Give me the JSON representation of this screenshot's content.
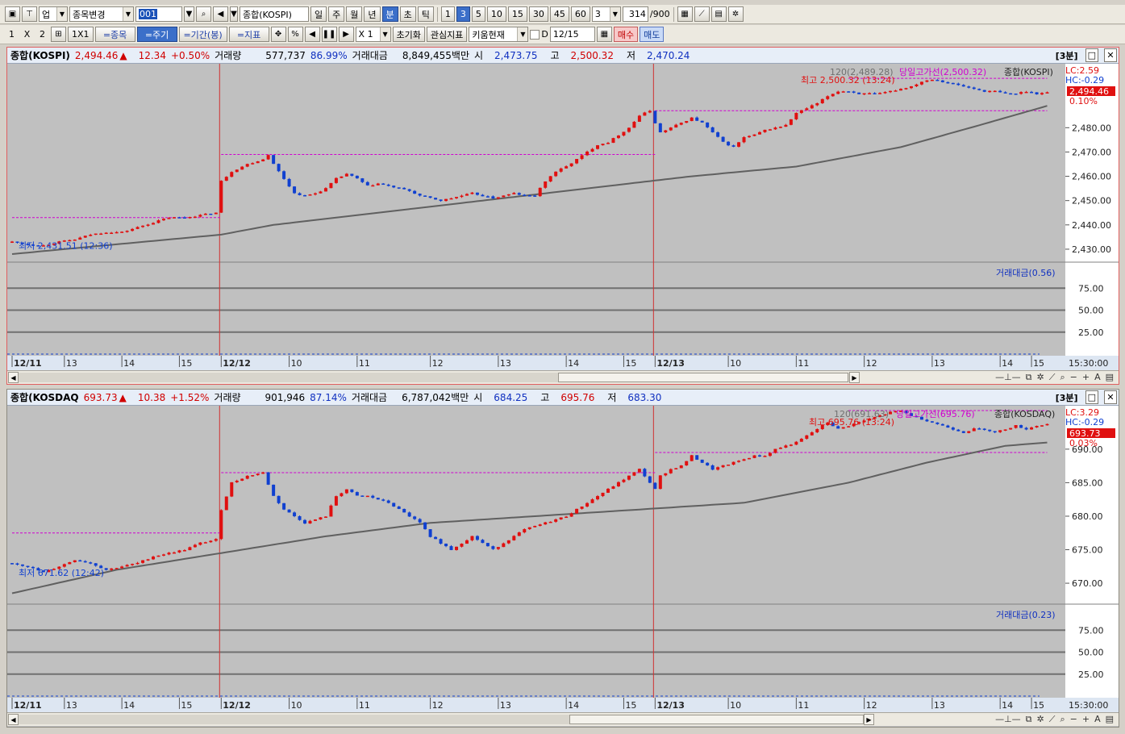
{
  "toolbar1": {
    "type_select": "업",
    "change_select": "종목변경",
    "code": "001",
    "name_field": "종합(KOSPI)",
    "periods": [
      "일",
      "주",
      "월",
      "년",
      "분",
      "초",
      "틱"
    ],
    "active_period": "분",
    "minute_options": [
      "1",
      "3",
      "5",
      "10",
      "15",
      "30",
      "45",
      "60"
    ],
    "active_minute": "3",
    "interval_value": "3",
    "count_value": "314",
    "count_max": "/900"
  },
  "toolbar2": {
    "layout_labels": [
      "1",
      "X",
      "2"
    ],
    "grid_label": "1X1",
    "tabs": [
      "=종목",
      "=주기",
      "=기간(봉)",
      "=지표"
    ],
    "active_tab": "=주기",
    "zoom_value": "X 1",
    "reset_label": "초기화",
    "watch_label": "관심지표",
    "kiwoom_label": "키움현재",
    "date_prefix": "D",
    "date_value": "12/15",
    "buy_label": "매수",
    "sell_label": "매도"
  },
  "panels": [
    {
      "name": "종합(KOSPI)",
      "price": "2,494.46",
      "arrow": "▲",
      "change": "12.34",
      "change_pct": "+0.50%",
      "volume_label": "거래량",
      "volume": "577,737",
      "volume_pct": "86.99%",
      "amount_label": "거래대금",
      "amount": "8,849,455백만",
      "open_label": "시",
      "open": "2,473.75",
      "high_label": "고",
      "high": "2,500.32",
      "low_label": "저",
      "low": "2,470.24",
      "period_badge": "[3분]",
      "y_labels": [
        "2,480.00",
        "2,470.00",
        "2,460.00",
        "2,450.00",
        "2,440.00",
        "2,430.00"
      ],
      "lc": "LC:2.59",
      "hc": "HC:-0.29",
      "last_price_tag": "2,494.46",
      "last_pct_tag": "0.10%",
      "ma_label": "120(2,489.28)",
      "high_line_label": "당일고가선(2,500.32)",
      "legend_name": "종합(KOSPI)",
      "max_label": "최고 2,500.32 (13:24)",
      "min_label": "최저 2,431.51 (12:36)",
      "sub_label": "거래대금(0.56)",
      "sub_y_labels": [
        "75.00",
        "50.00",
        "25.00"
      ],
      "x_labels": [
        "12/11",
        "13",
        "14",
        "15",
        "12/12",
        "10",
        "11",
        "12",
        "13",
        "14",
        "15",
        "12/13",
        "10",
        "11",
        "12",
        "13",
        "14",
        "15"
      ],
      "time_label": "15:30:00",
      "chart_data": {
        "type": "candlestick",
        "ylim": [
          2425,
          2505
        ],
        "sub_ylim": [
          0,
          100
        ],
        "close_points": [
          [
            0,
            2433
          ],
          [
            3,
            2432
          ],
          [
            6,
            2431.5
          ],
          [
            9,
            2433
          ],
          [
            12,
            2434
          ],
          [
            15,
            2436
          ],
          [
            18,
            2437
          ],
          [
            21,
            2437
          ],
          [
            24,
            2439
          ],
          [
            27,
            2441
          ],
          [
            30,
            2443
          ],
          [
            33,
            2443
          ],
          [
            36,
            2444
          ],
          [
            39,
            2445
          ],
          [
            40,
            2458
          ],
          [
            42,
            2462
          ],
          [
            45,
            2465
          ],
          [
            48,
            2467
          ],
          [
            49,
            2469
          ],
          [
            50,
            2465
          ],
          [
            52,
            2459
          ],
          [
            54,
            2453
          ],
          [
            56,
            2452
          ],
          [
            58,
            2453
          ],
          [
            60,
            2455
          ],
          [
            62,
            2459
          ],
          [
            64,
            2461
          ],
          [
            66,
            2459
          ],
          [
            68,
            2456
          ],
          [
            70,
            2457
          ],
          [
            72,
            2456
          ],
          [
            74,
            2455
          ],
          [
            76,
            2454
          ],
          [
            78,
            2452
          ],
          [
            80,
            2451
          ],
          [
            82,
            2450
          ],
          [
            84,
            2451
          ],
          [
            86,
            2452
          ],
          [
            88,
            2453
          ],
          [
            90,
            2452
          ],
          [
            92,
            2451
          ],
          [
            94,
            2452
          ],
          [
            96,
            2453
          ],
          [
            98,
            2452
          ],
          [
            100,
            2452
          ],
          [
            102,
            2458
          ],
          [
            104,
            2462
          ],
          [
            106,
            2464
          ],
          [
            108,
            2467
          ],
          [
            110,
            2470
          ],
          [
            112,
            2473
          ],
          [
            114,
            2474
          ],
          [
            116,
            2477
          ],
          [
            118,
            2480
          ],
          [
            120,
            2485
          ],
          [
            122,
            2487
          ],
          [
            123,
            2482
          ],
          [
            124,
            2478
          ],
          [
            126,
            2480
          ],
          [
            128,
            2482
          ],
          [
            130,
            2484
          ],
          [
            132,
            2482
          ],
          [
            134,
            2478
          ],
          [
            136,
            2474
          ],
          [
            138,
            2472
          ],
          [
            140,
            2476
          ],
          [
            142,
            2477
          ],
          [
            144,
            2479
          ],
          [
            146,
            2480
          ],
          [
            148,
            2481
          ],
          [
            150,
            2486
          ],
          [
            152,
            2488
          ],
          [
            154,
            2490
          ],
          [
            156,
            2493
          ],
          [
            158,
            2495
          ],
          [
            160,
            2495
          ],
          [
            162,
            2494
          ],
          [
            164,
            2494
          ],
          [
            166,
            2494
          ],
          [
            168,
            2495
          ],
          [
            170,
            2496
          ],
          [
            172,
            2497
          ],
          [
            174,
            2499
          ],
          [
            176,
            2500
          ],
          [
            178,
            2499
          ],
          [
            180,
            2498
          ],
          [
            182,
            2497
          ],
          [
            184,
            2496
          ],
          [
            186,
            2495
          ],
          [
            188,
            2495
          ],
          [
            190,
            2494
          ],
          [
            192,
            2494
          ],
          [
            194,
            2495
          ],
          [
            196,
            2494
          ],
          [
            198,
            2494.5
          ]
        ],
        "ma_points": [
          [
            0,
            2428
          ],
          [
            20,
            2432
          ],
          [
            40,
            2436
          ],
          [
            50,
            2440
          ],
          [
            70,
            2445
          ],
          [
            90,
            2450
          ],
          [
            110,
            2455
          ],
          [
            130,
            2460
          ],
          [
            150,
            2464
          ],
          [
            170,
            2472
          ],
          [
            185,
            2481
          ],
          [
            198,
            2489
          ]
        ],
        "high_line": 2500.32,
        "prev_high_steps": [
          [
            0,
            40,
            2443
          ],
          [
            40,
            123,
            2469
          ],
          [
            123,
            198,
            2487
          ]
        ]
      }
    },
    {
      "name": "종합(KOSDAQ",
      "price": "693.73",
      "arrow": "▲",
      "change": "10.38",
      "change_pct": "+1.52%",
      "volume_label": "거래량",
      "volume": "901,946",
      "volume_pct": "87.14%",
      "amount_label": "거래대금",
      "amount": "6,787,042백만",
      "open_label": "시",
      "open": "684.25",
      "high_label": "고",
      "high": "695.76",
      "low_label": "저",
      "low": "683.30",
      "period_badge": "[3분]",
      "y_labels": [
        "690.00",
        "685.00",
        "680.00",
        "675.00",
        "670.00"
      ],
      "lc": "LC:3.29",
      "hc": "HC:-0.29",
      "last_price_tag": "693.73",
      "last_pct_tag": "0.03%",
      "ma_label": "120(691.63)",
      "high_line_label": "당일고가선(695.76)",
      "legend_name": "종합(KOSDAQ)",
      "max_label": "최고 695.76 (13:24)",
      "min_label": "최저 671.62 (12:42)",
      "sub_label": "거래대금(0.23)",
      "sub_y_labels": [
        "75.00",
        "50.00",
        "25.00"
      ],
      "x_labels": [
        "12/11",
        "13",
        "14",
        "15",
        "12/12",
        "10",
        "11",
        "12",
        "13",
        "14",
        "15",
        "12/13",
        "10",
        "11",
        "12",
        "13",
        "14",
        "15"
      ],
      "time_label": "15:30:00",
      "chart_data": {
        "type": "candlestick",
        "ylim": [
          667,
          696
        ],
        "sub_ylim": [
          0,
          100
        ],
        "close_points": [
          [
            0,
            673
          ],
          [
            3,
            672.5
          ],
          [
            6,
            671.6
          ],
          [
            9,
            672.5
          ],
          [
            12,
            673.5
          ],
          [
            15,
            673
          ],
          [
            18,
            672
          ],
          [
            21,
            672.5
          ],
          [
            24,
            673
          ],
          [
            27,
            674
          ],
          [
            30,
            674.5
          ],
          [
            33,
            675
          ],
          [
            36,
            676
          ],
          [
            39,
            676.5
          ],
          [
            40,
            681
          ],
          [
            42,
            685
          ],
          [
            45,
            686
          ],
          [
            48,
            686.5
          ],
          [
            50,
            683
          ],
          [
            52,
            681
          ],
          [
            54,
            680
          ],
          [
            56,
            679
          ],
          [
            58,
            679.5
          ],
          [
            60,
            680
          ],
          [
            62,
            683
          ],
          [
            64,
            684
          ],
          [
            66,
            683
          ],
          [
            68,
            683
          ],
          [
            70,
            682.5
          ],
          [
            72,
            682
          ],
          [
            74,
            681
          ],
          [
            76,
            680
          ],
          [
            78,
            679
          ],
          [
            80,
            677
          ],
          [
            82,
            676
          ],
          [
            84,
            675
          ],
          [
            86,
            676
          ],
          [
            88,
            677
          ],
          [
            90,
            676
          ],
          [
            92,
            675
          ],
          [
            94,
            676
          ],
          [
            96,
            677
          ],
          [
            98,
            678
          ],
          [
            100,
            678.5
          ],
          [
            102,
            679
          ],
          [
            104,
            679.5
          ],
          [
            106,
            680
          ],
          [
            108,
            681
          ],
          [
            110,
            682
          ],
          [
            112,
            683
          ],
          [
            114,
            684
          ],
          [
            116,
            685
          ],
          [
            118,
            686
          ],
          [
            120,
            687
          ],
          [
            122,
            685
          ],
          [
            123,
            684
          ],
          [
            124,
            686
          ],
          [
            126,
            687
          ],
          [
            128,
            687.5
          ],
          [
            130,
            689
          ],
          [
            132,
            688
          ],
          [
            134,
            687
          ],
          [
            136,
            687.5
          ],
          [
            138,
            688
          ],
          [
            140,
            688.5
          ],
          [
            142,
            689
          ],
          [
            144,
            689
          ],
          [
            146,
            690
          ],
          [
            148,
            690.5
          ],
          [
            150,
            691
          ],
          [
            152,
            692
          ],
          [
            154,
            693
          ],
          [
            156,
            694
          ],
          [
            158,
            693
          ],
          [
            160,
            693.5
          ],
          [
            162,
            694
          ],
          [
            164,
            694.5
          ],
          [
            166,
            695
          ],
          [
            168,
            695.5
          ],
          [
            170,
            695.7
          ],
          [
            172,
            695
          ],
          [
            174,
            694.5
          ],
          [
            176,
            694
          ],
          [
            178,
            693.5
          ],
          [
            180,
            693
          ],
          [
            182,
            692.5
          ],
          [
            184,
            693
          ],
          [
            186,
            693
          ],
          [
            188,
            692.5
          ],
          [
            190,
            693
          ],
          [
            192,
            693.5
          ],
          [
            194,
            693
          ],
          [
            196,
            693.5
          ],
          [
            198,
            693.7
          ]
        ],
        "ma_points": [
          [
            0,
            668.5
          ],
          [
            20,
            672
          ],
          [
            40,
            674.5
          ],
          [
            60,
            677
          ],
          [
            80,
            679
          ],
          [
            100,
            680
          ],
          [
            120,
            681
          ],
          [
            140,
            682
          ],
          [
            160,
            685
          ],
          [
            175,
            688
          ],
          [
            190,
            690.5
          ],
          [
            198,
            691
          ]
        ],
        "high_line": 695.76,
        "prev_high_steps": [
          [
            0,
            40,
            677.5
          ],
          [
            40,
            123,
            686.5
          ],
          [
            123,
            198,
            689.5
          ]
        ]
      }
    }
  ],
  "colors": {
    "up": "#e01010",
    "down": "#1040d0",
    "ma": "#606060",
    "high_line": "#d000d0",
    "grid_bg": "#c0c0c0",
    "day_sep": "#d03030"
  }
}
